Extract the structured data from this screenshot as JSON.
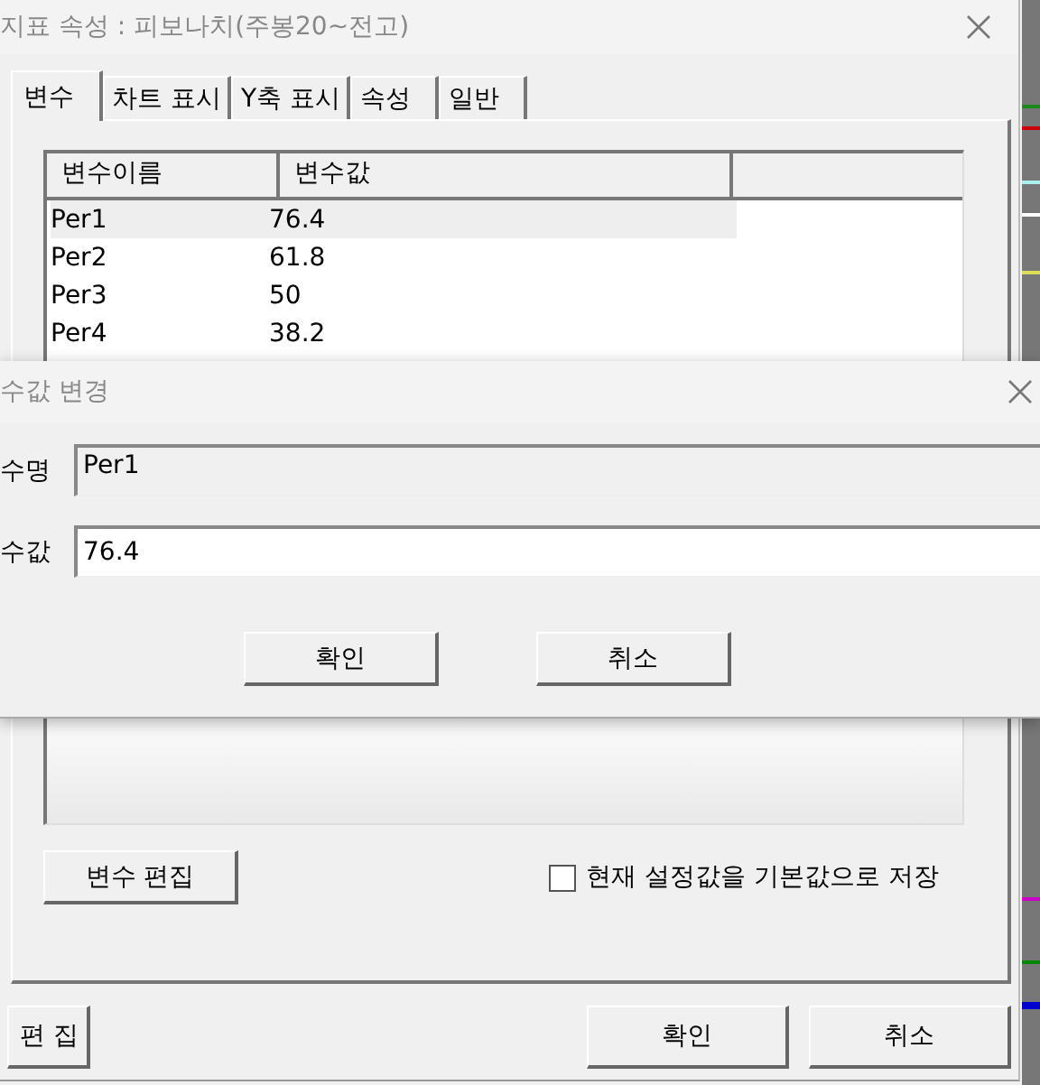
{
  "window": {
    "title": "지표 속성 : 피보나치(주봉20~전고)"
  },
  "tabs": [
    {
      "label": "변수",
      "selected": true
    },
    {
      "label": "차트 표시",
      "selected": false
    },
    {
      "label": "Y축 표시",
      "selected": false
    },
    {
      "label": "속성",
      "selected": false
    },
    {
      "label": "일반",
      "selected": false
    }
  ],
  "variable_list": {
    "columns": [
      "변수이름",
      "변수값"
    ],
    "rows": [
      {
        "name": "Per1",
        "value": "76.4",
        "selected": true
      },
      {
        "name": "Per2",
        "value": "61.8",
        "selected": false
      },
      {
        "name": "Per3",
        "value": "50",
        "selected": false
      },
      {
        "name": "Per4",
        "value": "38.2",
        "selected": false
      }
    ]
  },
  "edit_variable_button": "변수 편집",
  "save_default_checkbox": {
    "label": "현재 설정값을 기본값으로 저장",
    "checked": false
  },
  "footer_buttons": [
    {
      "label": "편 집",
      "kind": "left"
    },
    {
      "label": "확인",
      "kind": "right"
    },
    {
      "label": "취소",
      "kind": "right"
    }
  ],
  "dialog": {
    "title": "수값 변경",
    "fields": [
      {
        "label": "수명",
        "value": "Per1",
        "kind": "readonly"
      },
      {
        "label": "수값",
        "value": "76.4",
        "kind": "input"
      }
    ],
    "buttons": [
      "확인",
      "취소"
    ]
  }
}
